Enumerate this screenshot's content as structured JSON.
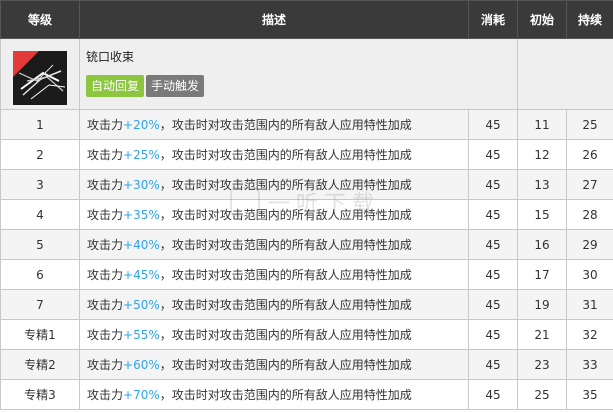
{
  "skill": {
    "name": "铳口收束",
    "icon": "skill-burst-icon",
    "tags": [
      {
        "label": "自动回复",
        "color": "#8cc63f"
      },
      {
        "label": "手动触发",
        "color": "#7a7a7a"
      }
    ]
  },
  "columns": [
    "等级",
    "描述",
    "消耗",
    "初始",
    "持续"
  ],
  "desc": {
    "prefix": "攻击力",
    "suffix": "，攻击时对攻击范围内的所有敌人应用特性加成"
  },
  "rows": [
    {
      "level": "1",
      "pct": "+20%",
      "cost": "45",
      "init": "11",
      "dur": "25"
    },
    {
      "level": "2",
      "pct": "+25%",
      "cost": "45",
      "init": "12",
      "dur": "26"
    },
    {
      "level": "3",
      "pct": "+30%",
      "cost": "45",
      "init": "13",
      "dur": "27"
    },
    {
      "level": "4",
      "pct": "+35%",
      "cost": "45",
      "init": "15",
      "dur": "28"
    },
    {
      "level": "5",
      "pct": "+40%",
      "cost": "45",
      "init": "16",
      "dur": "29"
    },
    {
      "level": "6",
      "pct": "+45%",
      "cost": "45",
      "init": "17",
      "dur": "30"
    },
    {
      "level": "7",
      "pct": "+50%",
      "cost": "45",
      "init": "19",
      "dur": "31"
    },
    {
      "level": "专精1",
      "pct": "+55%",
      "cost": "45",
      "init": "21",
      "dur": "32"
    },
    {
      "level": "专精2",
      "pct": "+60%",
      "cost": "45",
      "init": "23",
      "dur": "33"
    },
    {
      "level": "专精3",
      "pct": "+70%",
      "cost": "45",
      "init": "25",
      "dur": "35"
    }
  ],
  "watermark": {
    "text": "一听下载"
  },
  "colors": {
    "header_bg": "#3a3a3a",
    "accent_pct": "#2ea5e7"
  }
}
